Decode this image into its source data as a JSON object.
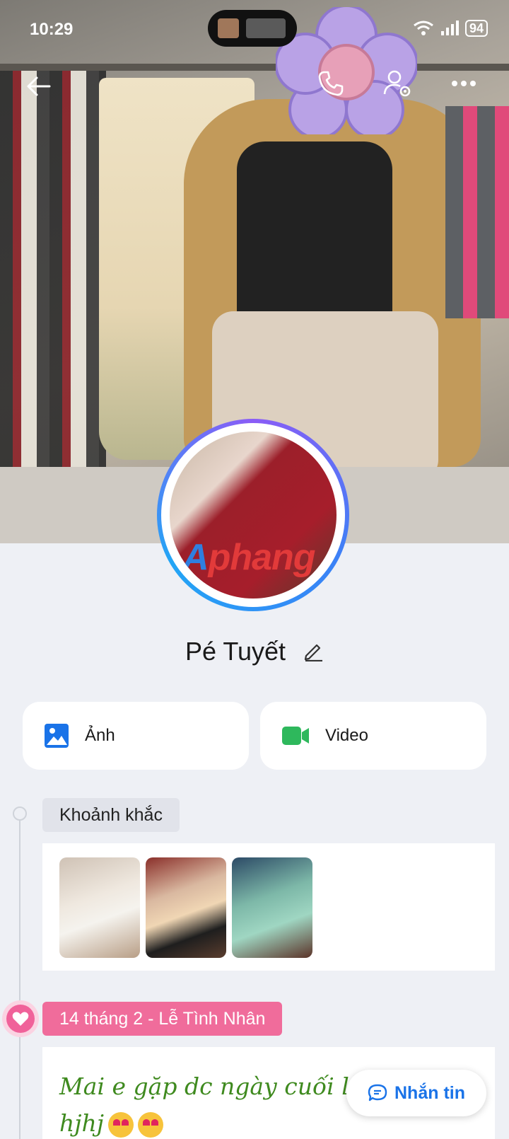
{
  "status_bar": {
    "time": "10:29",
    "battery": "94"
  },
  "profile": {
    "name": "Pé Tuyết",
    "watermark_a": "A",
    "watermark_b": "phang"
  },
  "media": {
    "photos_label": "Ảnh",
    "video_label": "Video"
  },
  "timeline": {
    "moments_label": "Khoảnh khắc",
    "event_label": "14 tháng 2 - Lễ Tình Nhân",
    "post_text_line1": "Mai e gặp dc ngày cuối là e ng",
    "post_text_line2": "hjhj"
  },
  "actions": {
    "message_label": "Nhắn tin"
  },
  "colors": {
    "accent": "#1a73e8",
    "valentine": "#f06c9b",
    "post_text": "#3f8a1f"
  }
}
